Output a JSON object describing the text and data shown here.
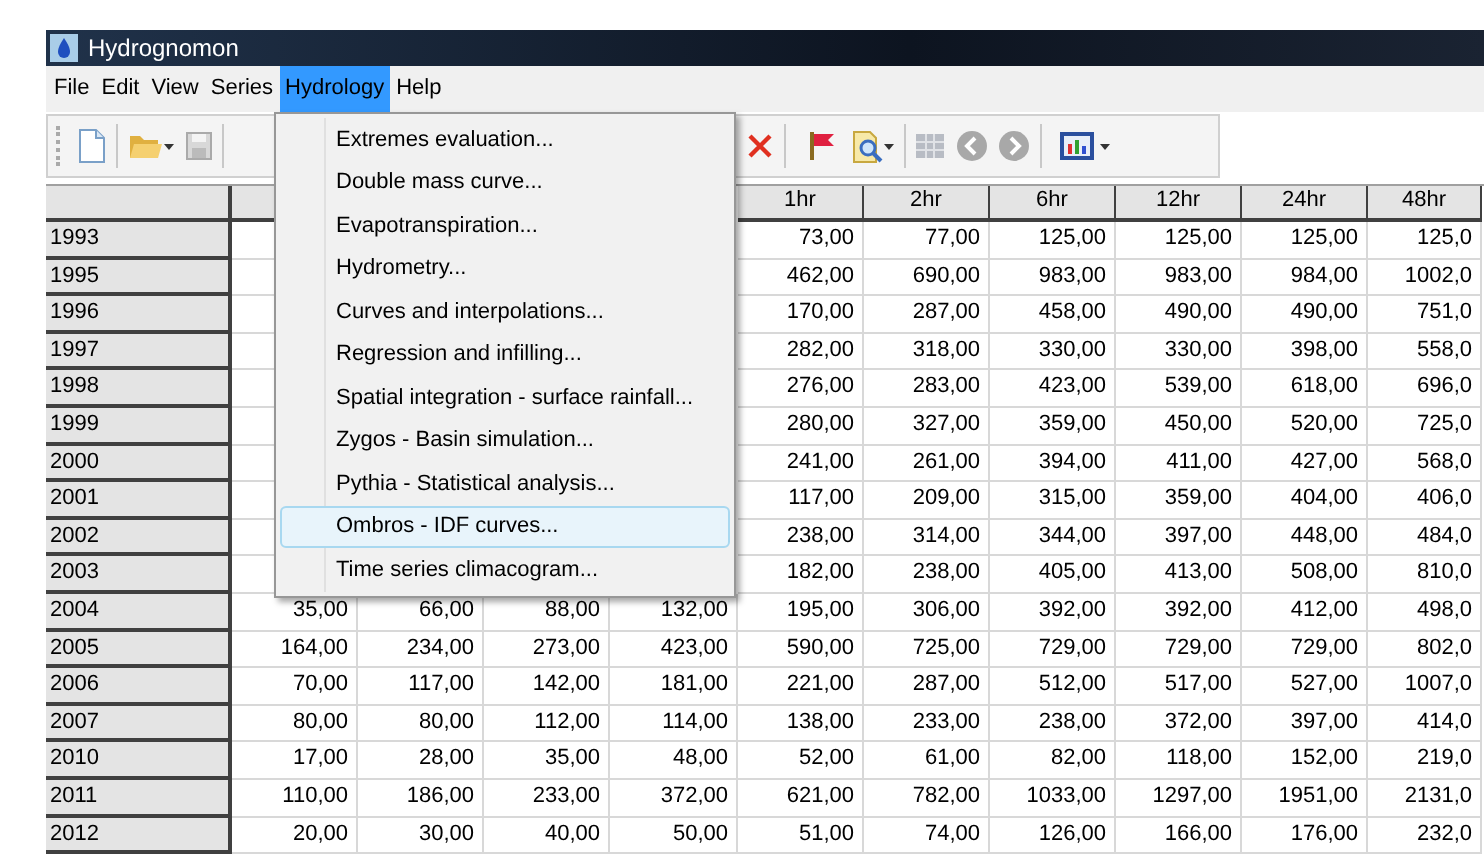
{
  "window": {
    "title": "Hydrognomon"
  },
  "menubar": [
    {
      "label": "File",
      "selected": false
    },
    {
      "label": "Edit",
      "selected": false
    },
    {
      "label": "View",
      "selected": false
    },
    {
      "label": "Series",
      "selected": false
    },
    {
      "label": "Hydrology",
      "selected": true
    },
    {
      "label": "Help",
      "selected": false
    }
  ],
  "menu": {
    "items": [
      {
        "label": "Extremes evaluation...",
        "selected": false
      },
      {
        "label": "Double mass curve...",
        "selected": false
      },
      {
        "label": "Evapotranspiration...",
        "selected": false
      },
      {
        "label": "Hydrometry...",
        "selected": false
      },
      {
        "label": "Curves and interpolations...",
        "selected": false
      },
      {
        "label": "Regression and infilling...",
        "selected": false
      },
      {
        "label": "Spatial integration - surface rainfall...",
        "selected": false
      },
      {
        "label": "Zygos - Basin simulation...",
        "selected": false
      },
      {
        "label": "Pythia - Statistical analysis...",
        "selected": false
      },
      {
        "label": "Ombros - IDF curves...",
        "selected": true
      },
      {
        "label": "Time series climacogram...",
        "selected": false
      }
    ]
  },
  "table": {
    "columns": [
      "1hr",
      "2hr",
      "6hr",
      "12hr",
      "24hr",
      "48hr"
    ],
    "rows": [
      {
        "year": "1993",
        "cells": [
          "73,00",
          "77,00",
          "125,00",
          "125,00",
          "125,00",
          "125,0"
        ]
      },
      {
        "year": "1995",
        "cells": [
          "462,00",
          "690,00",
          "983,00",
          "983,00",
          "984,00",
          "1002,0"
        ]
      },
      {
        "year": "1996",
        "cells": [
          "170,00",
          "287,00",
          "458,00",
          "490,00",
          "490,00",
          "751,0"
        ]
      },
      {
        "year": "1997",
        "cells": [
          "282,00",
          "318,00",
          "330,00",
          "330,00",
          "398,00",
          "558,0"
        ]
      },
      {
        "year": "1998",
        "cells": [
          "276,00",
          "283,00",
          "423,00",
          "539,00",
          "618,00",
          "696,0"
        ]
      },
      {
        "year": "1999",
        "cells": [
          "280,00",
          "327,00",
          "359,00",
          "450,00",
          "520,00",
          "725,0"
        ]
      },
      {
        "year": "2000",
        "cells": [
          "241,00",
          "261,00",
          "394,00",
          "411,00",
          "427,00",
          "568,0"
        ]
      },
      {
        "year": "2001",
        "cells": [
          "117,00",
          "209,00",
          "315,00",
          "359,00",
          "404,00",
          "406,0"
        ]
      },
      {
        "year": "2002",
        "cells": [
          "238,00",
          "314,00",
          "344,00",
          "397,00",
          "448,00",
          "484,0"
        ]
      },
      {
        "year": "2003",
        "cells": [
          "182,00",
          "238,00",
          "405,00",
          "413,00",
          "508,00",
          "810,0"
        ]
      },
      {
        "year": "2004",
        "cells": [
          "35,00",
          "66,00",
          "88,00",
          "132,00",
          "195,00",
          "306,00",
          "392,00",
          "392,00",
          "412,00",
          "498,0"
        ]
      },
      {
        "year": "2005",
        "cells": [
          "164,00",
          "234,00",
          "273,00",
          "423,00",
          "590,00",
          "725,00",
          "729,00",
          "729,00",
          "729,00",
          "802,0"
        ]
      },
      {
        "year": "2006",
        "cells": [
          "70,00",
          "117,00",
          "142,00",
          "181,00",
          "221,00",
          "287,00",
          "512,00",
          "517,00",
          "527,00",
          "1007,0"
        ]
      },
      {
        "year": "2007",
        "cells": [
          "80,00",
          "80,00",
          "112,00",
          "114,00",
          "138,00",
          "233,00",
          "238,00",
          "372,00",
          "397,00",
          "414,0"
        ]
      },
      {
        "year": "2010",
        "cells": [
          "17,00",
          "28,00",
          "35,00",
          "48,00",
          "52,00",
          "61,00",
          "82,00",
          "118,00",
          "152,00",
          "219,0"
        ]
      },
      {
        "year": "2011",
        "cells": [
          "110,00",
          "186,00",
          "233,00",
          "372,00",
          "621,00",
          "782,00",
          "1033,00",
          "1297,00",
          "1951,00",
          "2131,0"
        ]
      },
      {
        "year": "2012",
        "cells": [
          "20,00",
          "30,00",
          "40,00",
          "50,00",
          "51,00",
          "74,00",
          "126,00",
          "166,00",
          "176,00",
          "232,0"
        ]
      }
    ]
  }
}
